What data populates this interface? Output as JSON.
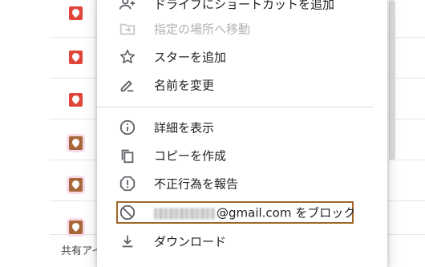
{
  "background": {
    "footer_text": "共有アイ"
  },
  "menu": {
    "items": [
      {
        "label": "ドライブにショートカットを追加",
        "icon": "add-shortcut-icon",
        "disabled": false
      },
      {
        "label": "指定の場所へ移動",
        "icon": "move-folder-icon",
        "disabled": true
      },
      {
        "label": "スターを追加",
        "icon": "star-icon",
        "disabled": false
      },
      {
        "label": "名前を変更",
        "icon": "rename-pencil-icon",
        "disabled": false
      },
      {
        "label": "詳細を表示",
        "icon": "info-icon",
        "disabled": false
      },
      {
        "label": "コピーを作成",
        "icon": "copy-icon",
        "disabled": false
      },
      {
        "label": "不正行為を報告",
        "icon": "report-icon",
        "disabled": false
      },
      {
        "label": "@gmail.com をブロック",
        "icon": "block-icon",
        "disabled": false
      },
      {
        "label": "ダウンロード",
        "icon": "download-icon",
        "disabled": false
      }
    ]
  },
  "colors": {
    "map_red": "#e0453a",
    "map_brown": "#a8663a",
    "highlight_border": "#a0662a",
    "disabled_text": "#b0b0b0"
  }
}
